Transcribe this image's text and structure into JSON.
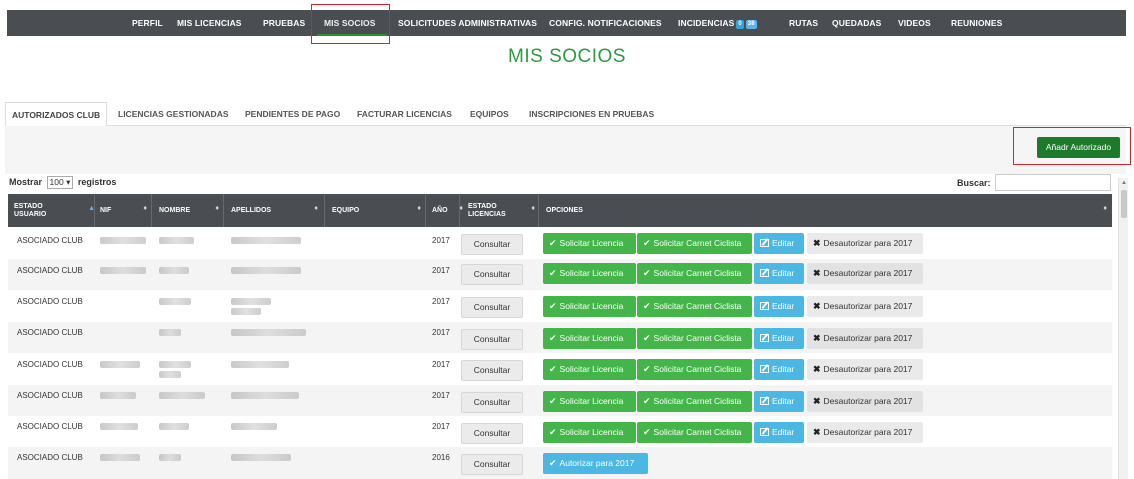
{
  "topnav": {
    "items": [
      {
        "label": "PERFIL"
      },
      {
        "label": "MIS LICENCIAS"
      },
      {
        "label": "PRUEBAS"
      },
      {
        "label": "MIS SOCIOS"
      },
      {
        "label": "SOLICITUDES ADMINISTRATIVAS"
      },
      {
        "label": "CONFIG. NOTIFICACIONES"
      },
      {
        "label": "INCIDENCIAS",
        "badge1": "0",
        "badge2": "38"
      },
      {
        "label": "RUTAS"
      },
      {
        "label": "QUEDADAS"
      },
      {
        "label": "VIDEOS"
      },
      {
        "label": "REUNIONES"
      }
    ],
    "active": "MIS SOCIOS"
  },
  "page_title": "MIS SOCIOS",
  "tabs": [
    {
      "label": "AUTORIZADOS CLUB"
    },
    {
      "label": "LICENCIAS GESTIONADAS"
    },
    {
      "label": "PENDIENTES DE PAGO"
    },
    {
      "label": "FACTURAR LICENCIAS"
    },
    {
      "label": "EQUIPOS"
    },
    {
      "label": "INSCRIPCIONES EN PRUEBAS"
    }
  ],
  "add_button": "Añadr Autorizado",
  "table_controls": {
    "show_prefix": "Mostrar",
    "page_size": "100",
    "show_suffix": "registros",
    "search_label": "Buscar:",
    "search_value": ""
  },
  "table": {
    "headers": {
      "estado_usuario": "ESTADO USUARIO",
      "nif": "NIF",
      "nombre": "NOMBRE",
      "apellidos": "APELLIDOS",
      "equipo": "EQUIPO",
      "anio": "AÑO",
      "estado_licencias": "ESTADO LICENCIAS",
      "opciones": "OPCIONES"
    },
    "actions": {
      "consultar": "Consultar",
      "solicitar_licencia": "Solicitar Licencia",
      "solicitar_carnet": "Solicitar Carnet Ciclista",
      "editar": "Editar",
      "desautorizar": "Desautorizar para 2017",
      "autorizar": "Autorizar para 2017"
    },
    "rows": [
      {
        "estado": "ASOCIADO CLUB",
        "anio": "2017",
        "type": "authorized"
      },
      {
        "estado": "ASOCIADO CLUB",
        "anio": "2017",
        "type": "authorized"
      },
      {
        "estado": "ASOCIADO CLUB",
        "anio": "2017",
        "type": "authorized"
      },
      {
        "estado": "ASOCIADO CLUB",
        "anio": "2017",
        "type": "authorized"
      },
      {
        "estado": "ASOCIADO CLUB",
        "anio": "2017",
        "type": "authorized"
      },
      {
        "estado": "ASOCIADO CLUB",
        "anio": "2017",
        "type": "authorized"
      },
      {
        "estado": "ASOCIADO CLUB",
        "anio": "2017",
        "type": "authorized"
      },
      {
        "estado": "ASOCIADO CLUB",
        "anio": "2016",
        "type": "unauthorized"
      }
    ]
  },
  "colors": {
    "nav_bg": "#4a4e52",
    "title_green": "#2e9a3f",
    "btn_green": "#44b548",
    "btn_dark_green": "#1e7a2b",
    "btn_blue": "#4cb7e3",
    "highlight_red": "#d9232b"
  },
  "icons": {
    "check": "check-icon",
    "edit": "edit-icon",
    "remove": "times-icon",
    "sort": "sort-icon"
  }
}
